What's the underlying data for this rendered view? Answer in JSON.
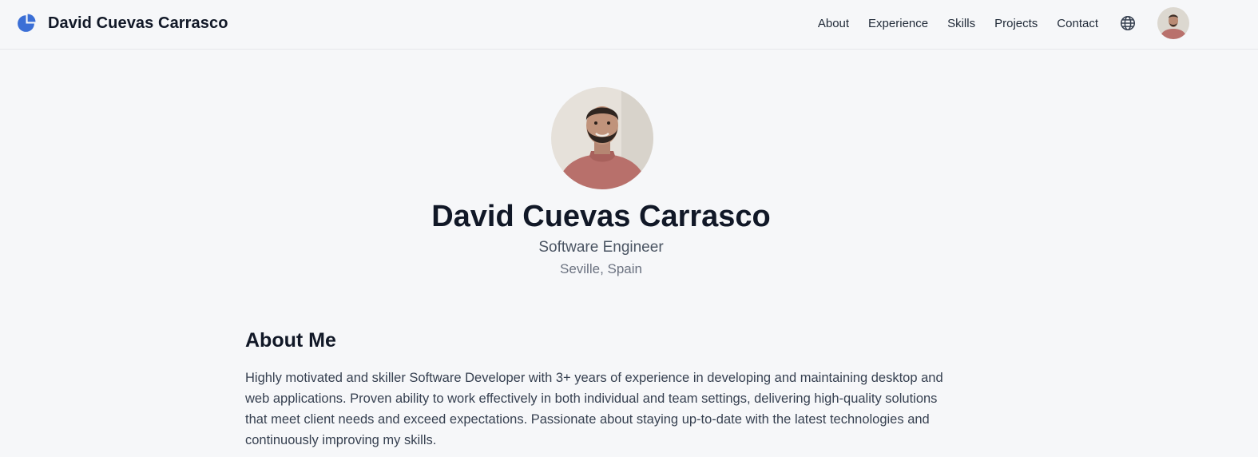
{
  "header": {
    "brand_name": "David Cuevas Carrasco",
    "logo_icon": "pie-logo-icon",
    "nav": [
      {
        "label": "About"
      },
      {
        "label": "Experience"
      },
      {
        "label": "Skills"
      },
      {
        "label": "Projects"
      },
      {
        "label": "Contact"
      }
    ],
    "language_icon": "globe-icon",
    "avatar_icon": "profile-avatar"
  },
  "hero": {
    "name": "David Cuevas Carrasco",
    "role": "Software Engineer",
    "location": "Seville, Spain"
  },
  "about": {
    "title": "About Me",
    "text": "Highly motivated and skiller Software Developer with 3+ years of experience in developing and maintaining desktop and web applications. Proven ability to work effectively in both individual and team settings, delivering high-quality solutions that meet client needs and exceed expectations. Passionate about staying up-to-date with the latest technologies and continuously improving my skills."
  },
  "colors": {
    "accent": "#3b6fd6",
    "background": "#f6f7f9",
    "text": "#111827",
    "muted": "#6b7280"
  }
}
